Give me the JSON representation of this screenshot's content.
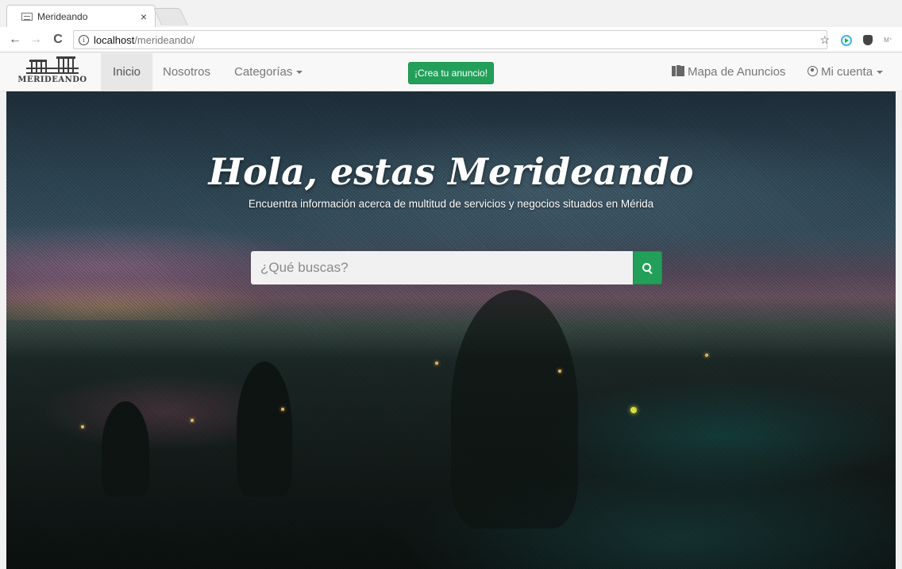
{
  "browser": {
    "tab_title": "Merideando",
    "tab_close": "×",
    "url_host": "localhost",
    "url_path": "/merideando/"
  },
  "navbar": {
    "brand": "MERIDEANDO",
    "links": [
      {
        "label": "Inicio",
        "active": true
      },
      {
        "label": "Nosotros",
        "active": false
      },
      {
        "label": "Categorías",
        "active": false
      }
    ],
    "cta_label": "¡Crea tu anuncio!",
    "map_label": "Mapa de Anuncios",
    "account_label": "Mi cuenta"
  },
  "hero": {
    "title": "Hola, estas Merideando",
    "subtitle": "Encuentra información acerca de multitud de servicios y negocios situados en Mérida",
    "search_placeholder": "¿Qué buscas?"
  },
  "colors": {
    "accent": "#22a05a",
    "navbar_bg": "#f8f8f8"
  }
}
